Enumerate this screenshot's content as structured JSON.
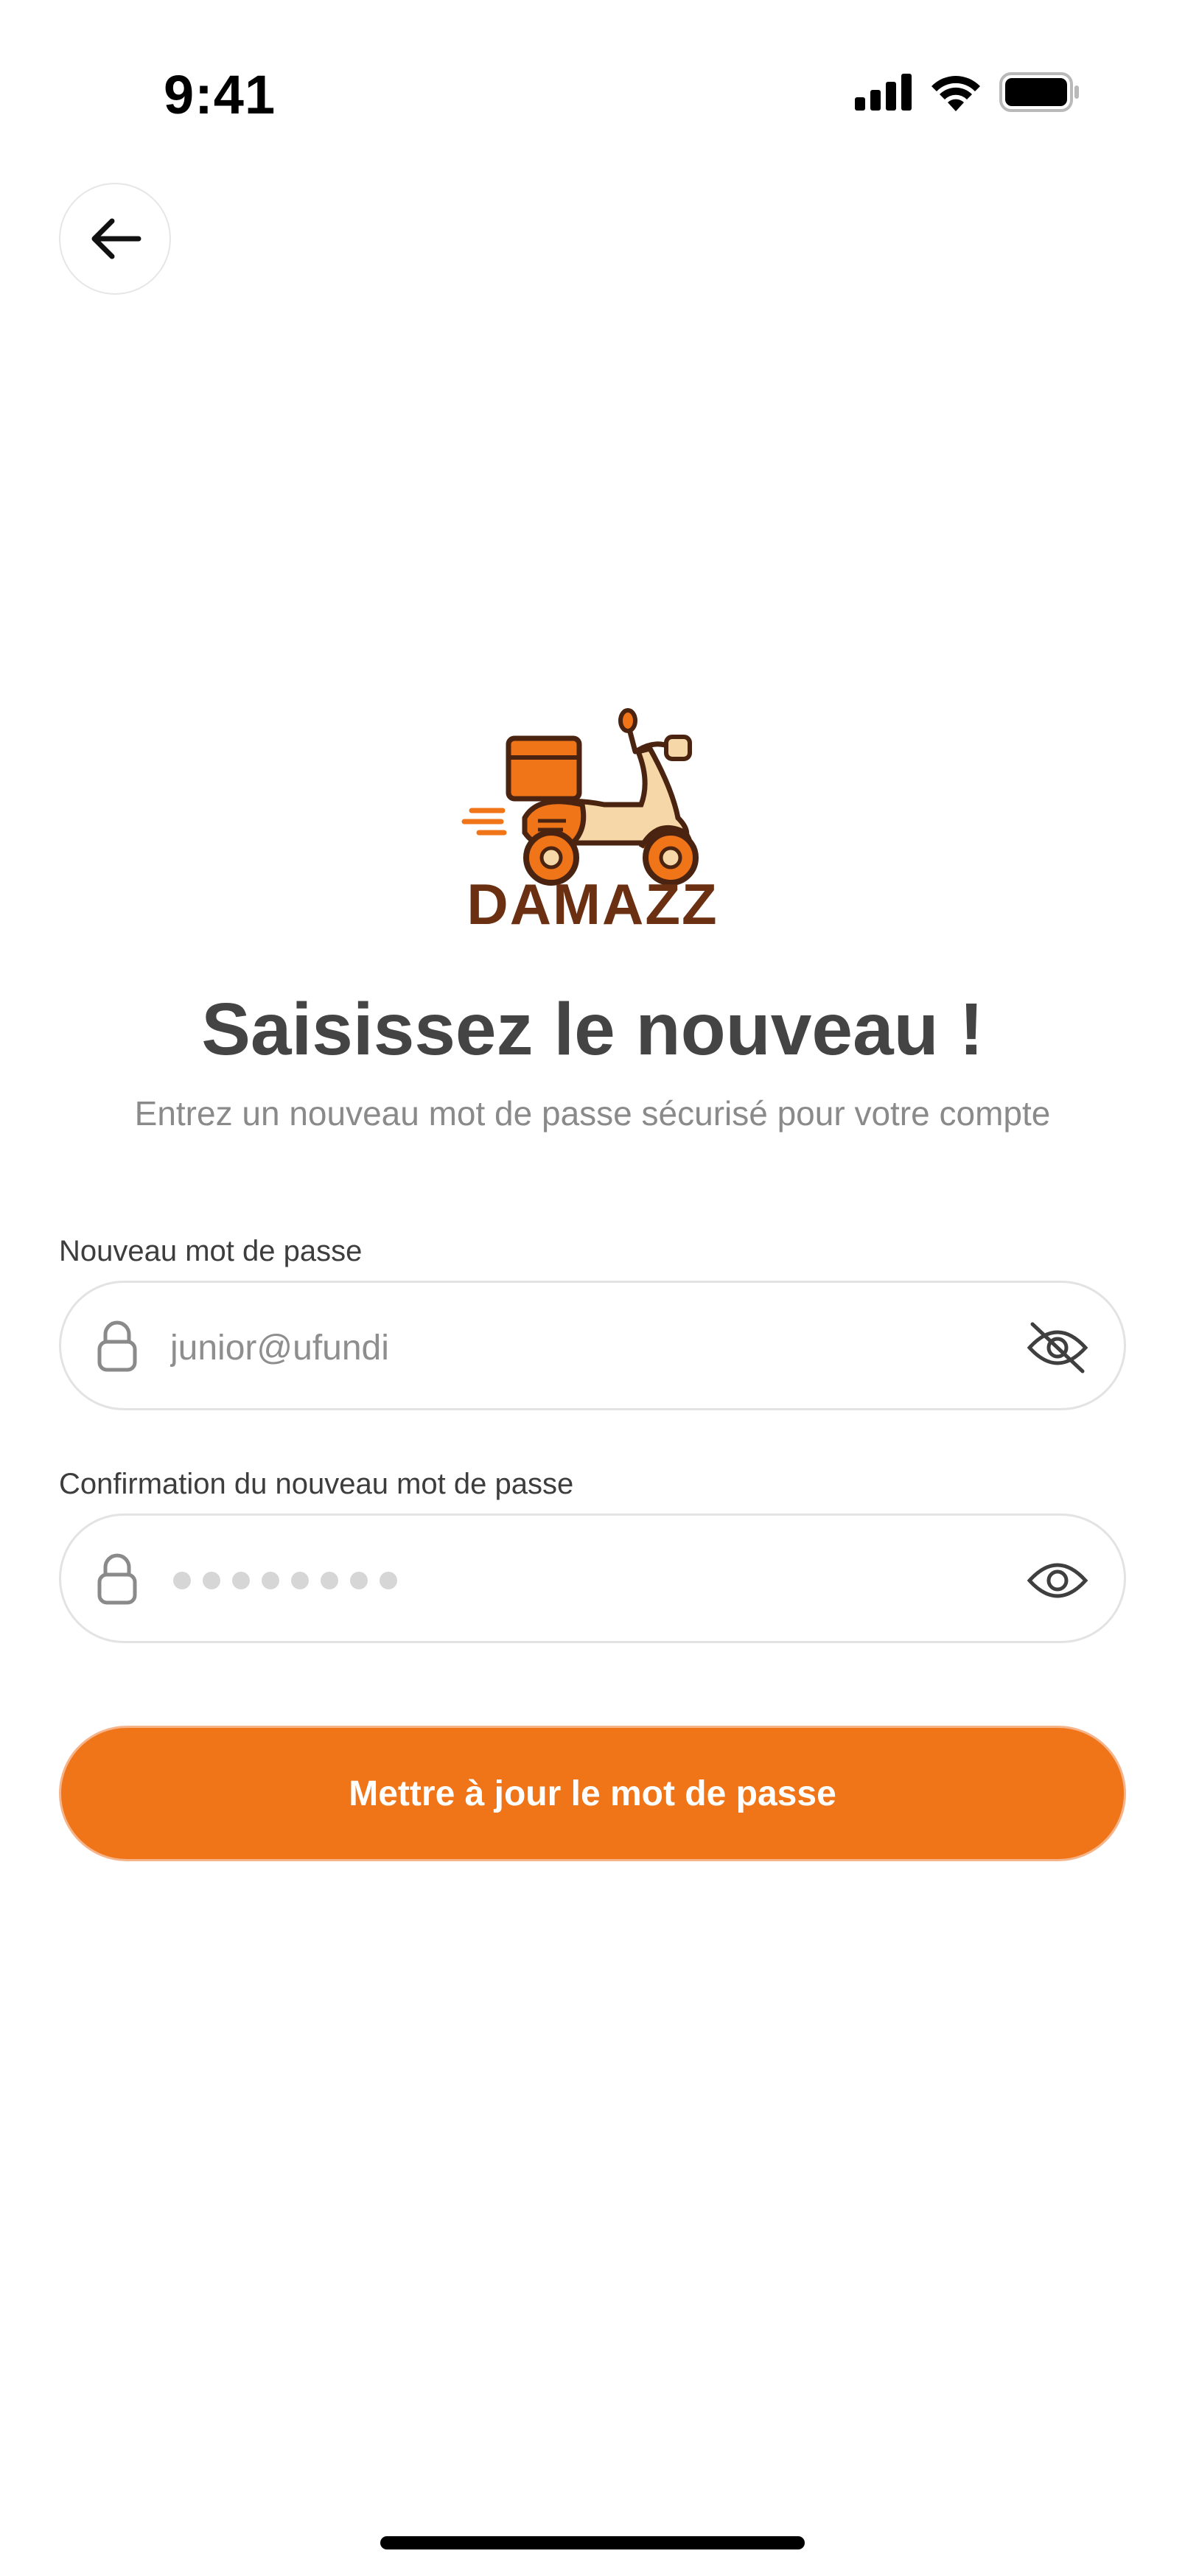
{
  "status_bar": {
    "time": "9:41"
  },
  "back_button": {
    "icon": "arrow-left-icon"
  },
  "brand": {
    "name": "DAMAZZ",
    "primary_color": "#f07418",
    "text_color": "#6b2f12"
  },
  "header": {
    "title": "Saisissez le nouveau !",
    "subtitle": "Entrez un nouveau mot de passe sécurisé pour votre compte"
  },
  "form": {
    "new_password": {
      "label": "Nouveau mot de passe",
      "value": "junior@ufundi",
      "visibility_icon": "eye-off-icon"
    },
    "confirm_password": {
      "label": "Confirmation du nouveau mot de passe",
      "masked_length": 8,
      "visibility_icon": "eye-icon"
    },
    "submit_label": "Mettre à jour le mot de passe"
  }
}
